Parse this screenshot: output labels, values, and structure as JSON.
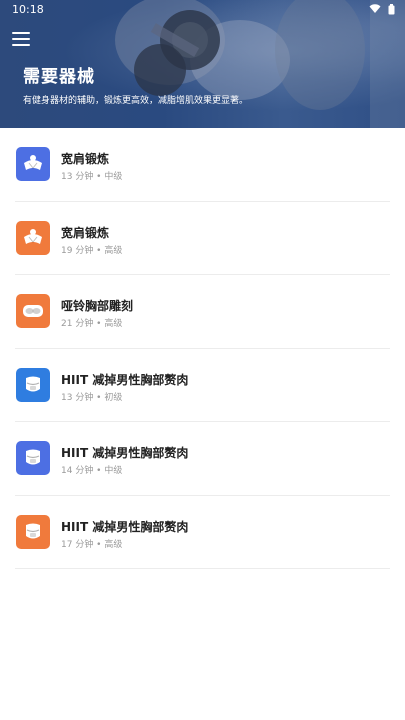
{
  "status_bar": {
    "time": "10:18"
  },
  "header": {
    "title": "需要器械",
    "subtitle": "有健身器材的辅助，锻炼更高效，减脂增肌效果更显著。"
  },
  "colors": {
    "header": "#2a4a80",
    "blue": "#3f6fe0",
    "orange": "#f07a3c",
    "title": "#222222",
    "meta": "#9a9a9a"
  },
  "workouts": [
    {
      "title": "宽肩锻炼",
      "meta": "13 分钟 • 中级",
      "color": "#4d6fe3",
      "icon": "shoulders-icon"
    },
    {
      "title": "宽肩锻炼",
      "meta": "19 分钟 • 高级",
      "color": "#f07a3c",
      "icon": "shoulders-icon"
    },
    {
      "title": "哑铃胸部雕刻",
      "meta": "21 分钟 • 高级",
      "color": "#f07a3c",
      "icon": "chest-icon"
    },
    {
      "title": "HIIT 减掉男性胸部赘肉",
      "meta": "13 分钟 • 初级",
      "color": "#2f7de0",
      "icon": "torso-icon"
    },
    {
      "title": "HIIT 减掉男性胸部赘肉",
      "meta": "14 分钟 • 中级",
      "color": "#4d6fe3",
      "icon": "torso-icon"
    },
    {
      "title": "HIIT 减掉男性胸部赘肉",
      "meta": "17 分钟 • 高级",
      "color": "#f07a3c",
      "icon": "torso-icon"
    }
  ]
}
